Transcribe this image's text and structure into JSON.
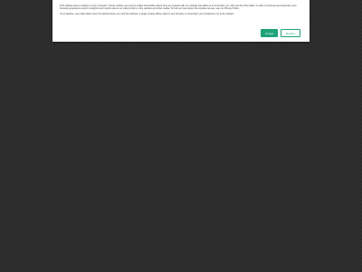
{
  "cookie_banner": {
    "paragraph_1": "This website stores cookies on your computer. These cookies are used to collect information about how you interact with our website and allow us to remember you. We use this information in order to improve and customize your browsing experience and for analytics and metrics about our visitors both on this website and other media. To find out more about the cookies we use, see our Privacy Policy.",
    "paragraph_2": "If you decline, your information won't be tracked when you visit this website. A single cookie will be used in your browser to remember your preference not to be tracked.",
    "accept_label": "Accept",
    "decline_label": "Decline"
  },
  "colors": {
    "accent": "#1fa37a",
    "page_background": "#2b2b2b",
    "banner_background": "#ffffff"
  }
}
